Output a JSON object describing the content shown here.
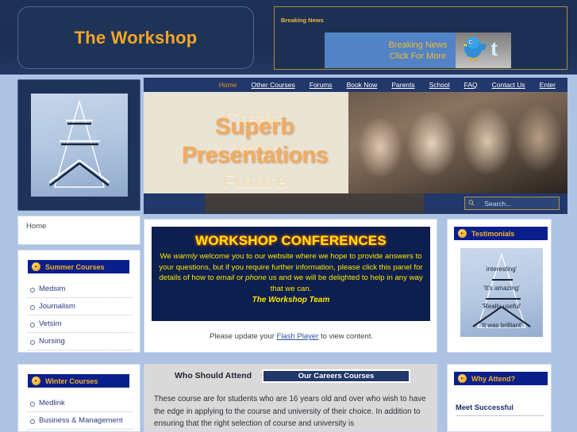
{
  "header": {
    "site_title": "The Workshop",
    "news_label": "Breaking News",
    "news_line1": "Breaking News",
    "news_line2": "Click For More",
    "bird_icon": "twitter-bird-icon"
  },
  "nav": {
    "items": [
      {
        "label": "Home",
        "active": true
      },
      {
        "label": "Other Courses",
        "active": false
      },
      {
        "label": "Forums",
        "active": false
      },
      {
        "label": "Book Now",
        "active": false
      },
      {
        "label": "Parents",
        "active": false
      },
      {
        "label": "School",
        "active": false
      },
      {
        "label": "FAQ",
        "active": false
      },
      {
        "label": "Contact Us",
        "active": false
      },
      {
        "label": "Enter",
        "active": false
      }
    ]
  },
  "banner": {
    "ghost_line1": "Create",
    "ghost_line2": "Your",
    "ghost_line3": "Future",
    "hi_line1": "Superb",
    "hi_line2": "Presentations"
  },
  "search": {
    "placeholder": "Search...",
    "icon": "magnifier-icon"
  },
  "sidebar": {
    "logo_alt": "pyramid-logo",
    "breadcrumb": "Home",
    "sections": [
      {
        "title": "Summer Courses",
        "icon": "orange-arrow-icon",
        "items": [
          "Medsim",
          "Journalism",
          "Vetsim",
          "Nursing"
        ]
      },
      {
        "title": "Winter Courses",
        "icon": "orange-arrow-icon",
        "items": [
          "Medlink",
          "Business & Management"
        ]
      }
    ]
  },
  "main": {
    "conference": {
      "title": "WORKSHOP CONFERENCES",
      "body_1": "We ",
      "body_em1": "warmly",
      "body_2": " welcome you to our website where we hope to provide answers to your questions, but if you require further information, please click this panel for details of how to ",
      "body_em2": "email",
      "body_3": " or ",
      "body_em3": "phone",
      "body_4": " us and we will be delighted to help in any way that we can.",
      "signature": "The Workshop Team"
    },
    "flash": {
      "pre": "Please update your ",
      "link": "Flash Player",
      "post": " to view content."
    },
    "tabs": [
      {
        "label": "Who Should Attend",
        "active": false
      },
      {
        "label": "Our Careers Courses",
        "active": true
      }
    ],
    "paragraph": "These course are for students who are 16 years old and over who wish to have the edge in applying to the course and university of their choice. In addition to ensuring  that the right selection of course and university is"
  },
  "right": {
    "testimonials": {
      "title": "Testimonials",
      "icon": "orange-arrow-icon",
      "quotes": [
        "interesting'",
        "'It's amazing'",
        "'Really useful'",
        "'It was brilliant'"
      ]
    },
    "why_attend": {
      "title": "Why Attend?",
      "icon": "orange-arrow-icon",
      "sub": "Meet Successful"
    }
  },
  "colors": {
    "header_navy": "#1d3054",
    "accent_orange": "#f5a623",
    "page_blue": "#aec2e3",
    "panel_head_blue": "#0b1f8c",
    "conf_navy": "#0d1f4f",
    "conf_yellow": "#ffe600",
    "tab_navy": "#22376a"
  }
}
